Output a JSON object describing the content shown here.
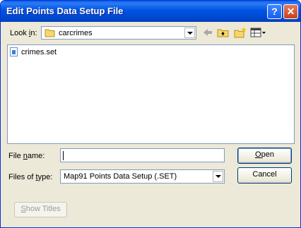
{
  "window": {
    "title": "Edit Points Data Setup File"
  },
  "title_buttons": {
    "help": "?",
    "close": "✕"
  },
  "lookin": {
    "label_pre": "Look ",
    "label_key": "i",
    "label_post": "n:",
    "value": "carcrimes"
  },
  "files": [
    {
      "name": "crimes.set",
      "icon": "setup-file-icon"
    }
  ],
  "filename": {
    "label_pre": "File ",
    "label_key": "n",
    "label_post": "ame:",
    "value": ""
  },
  "filetype": {
    "label_pre": "Files of ",
    "label_key": "t",
    "label_post": "ype:",
    "value": "Map91 Points Data Setup (.SET)"
  },
  "buttons": {
    "open_key": "O",
    "open_rest": "pen",
    "cancel": "Cancel",
    "show_titles_key": "S",
    "show_titles_rest": "how Titles"
  },
  "colors": {
    "titlebar": "#0054e3",
    "face": "#ece9d8",
    "border": "#7f9db9"
  }
}
